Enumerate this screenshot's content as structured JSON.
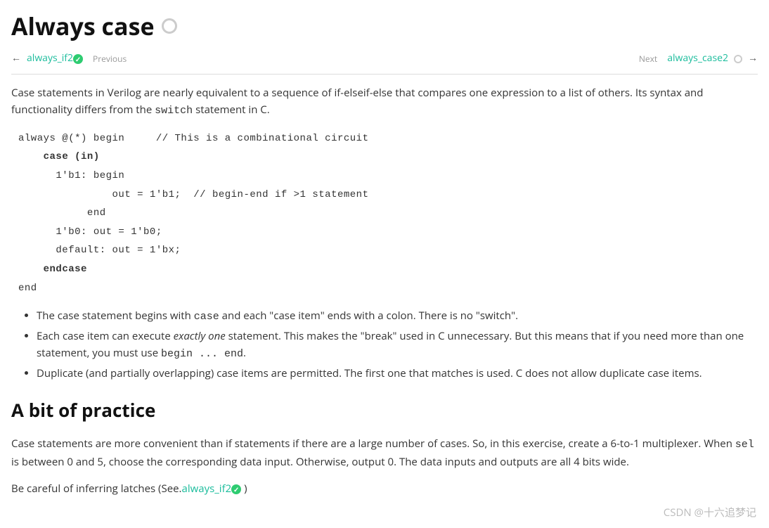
{
  "header": {
    "title": "Always case"
  },
  "nav": {
    "prev_link": "always_if2",
    "prev_label": "Previous",
    "next_label": "Next",
    "next_link": "always_case2"
  },
  "intro": {
    "part1": "Case statements in Verilog are nearly equivalent to a sequence of if-elseif-else that compares one expression to a list of others. Its syntax and functionality differs from the ",
    "code1": "switch",
    "part2": " statement in C."
  },
  "code_block": {
    "l1a": "always @(*) begin     // This is a combinational circuit",
    "l2a": "    ",
    "l2b": "case (in)",
    "l3a": "      1'b1: begin",
    "l4a": "               out = 1'b1;  // begin-end if >1 statement",
    "l5a": "           end",
    "l6a": "      1'b0: out = 1'b0;",
    "l7a": "      default: out = 1'bx;",
    "l8a": "    ",
    "l8b": "endcase",
    "l9a": "end"
  },
  "bullets": {
    "b1_p1": "The case statement begins with ",
    "b1_code": "case",
    "b1_p2": " and each \"case item\" ends with a colon. There is no \"switch\".",
    "b2_p1": "Each case item can execute ",
    "b2_em": "exactly one",
    "b2_p2": " statement. This makes the \"break\" used in C unnecessary. But this means that if you need more than one statement, you must use ",
    "b2_code": "begin ... end",
    "b2_p3": ".",
    "b3": "Duplicate (and partially overlapping) case items are permitted. The first one that matches is used. C does not allow duplicate case items."
  },
  "practice": {
    "heading": "A bit of practice",
    "p1_a": "Case statements are more convenient than if statements if there are a large number of cases. So, in this exercise, create a 6-to-1 multiplexer. When ",
    "p1_code": "sel",
    "p1_b": " is between 0 and 5, choose the corresponding data input. Otherwise, output 0. The data inputs and outputs are all 4 bits wide.",
    "p2_a": "Be careful of inferring latches (See.",
    "p2_link": "always_if2",
    "p2_b": " )"
  },
  "watermark": "CSDN @十六追梦记"
}
